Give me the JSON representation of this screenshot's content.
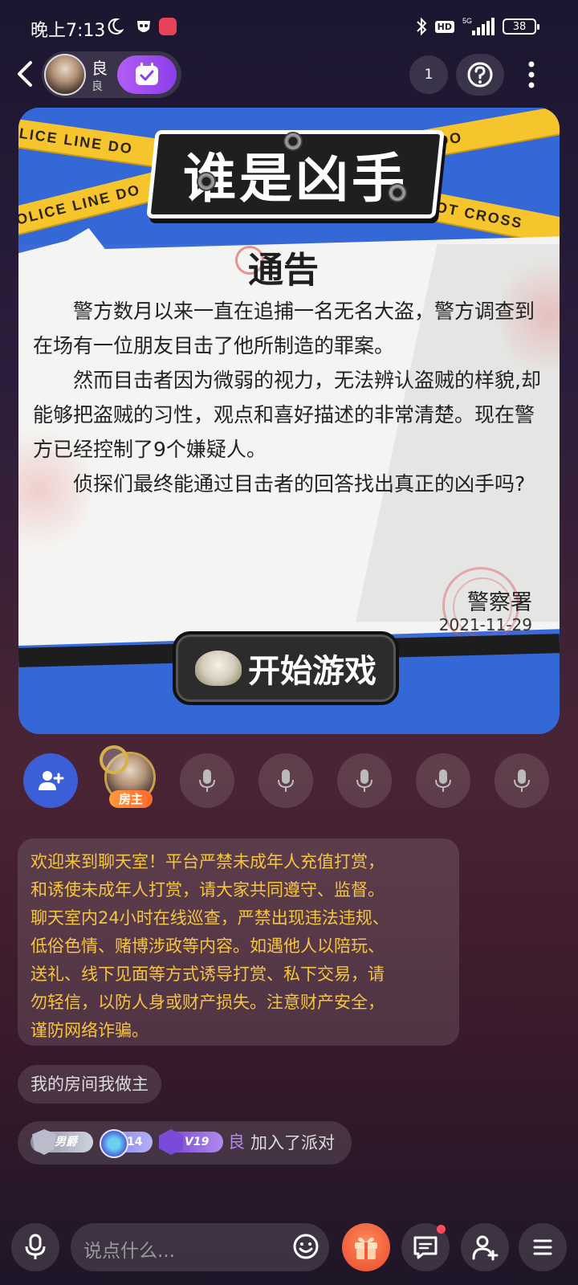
{
  "status_bar": {
    "time": "晚上7:13",
    "network": "5G",
    "hd": "HD",
    "battery": "38",
    "icons": [
      "moon-icon",
      "mask-app-icon",
      "app-icon",
      "bluetooth-icon",
      "signal-icon",
      "battery-icon"
    ]
  },
  "header": {
    "room_name": "良",
    "room_id": "良",
    "online_count": "1",
    "icons": [
      "back-icon",
      "checkin-icon",
      "help-icon",
      "more-icon"
    ]
  },
  "game_card": {
    "tape_text": "POLICE LINE DO",
    "tape_text_2": "POLICE LINE DO",
    "tape_text_3": "POLICE LINE DO",
    "tape_text_4": "NE DO NOT CROSS",
    "game_title": "谁是凶手",
    "notice_title": "通告",
    "notice_paragraphs": [
      "警方数月以来一直在追捕一名无名大盗，警方调查到在场有一位朋友目击了他所制造的罪案。",
      "然而目击者因为微弱的视力，无法辨认盗贼的样貌,却能够把盗贼的习性，观点和喜好描述的非常清楚。现在警方已经控制了9个嫌疑人。",
      "侦探们最终能通过目击者的回答找出真正的凶手吗?"
    ],
    "signer": "警察署",
    "date": "2021-11-29",
    "start_button": "开始游戏"
  },
  "seats": {
    "host_badge": "房主",
    "empty_seat_count": 5,
    "icons": [
      "add-user-icon",
      "mic-icon"
    ]
  },
  "chat": {
    "system_message_lines": [
      "欢迎来到聊天室！平台严禁未成年人充值打赏，",
      "和诱使未成年人打赏，请大家共同遵守、监督。",
      "聊天室内24小时在线巡查，严禁出现违法违规、",
      "低俗色情、赌博涉政等内容。如遇他人以陪玩、",
      "送礼、线下见面等方式诱导打赏、私下交易，请",
      "勿轻信，以防人身或财产损失。注意财产安全，",
      "谨防网络诈骗。"
    ],
    "room_rule": "我的房间我做主",
    "join_badges": {
      "knight": "男爵",
      "level": "14",
      "vip": "V19"
    },
    "join_user": "良",
    "join_text": "加入了派对"
  },
  "bottom_bar": {
    "input_placeholder": "说点什么...",
    "icons": [
      "mic-icon",
      "emoji-icon",
      "gift-icon",
      "message-icon",
      "add-friend-icon",
      "menu-icon"
    ]
  },
  "colors": {
    "accent_purple": "#8b3fe8",
    "system_text": "#f5c542",
    "invite_blue": "#3c5fd8",
    "card_blue": "#3468d6",
    "tape_yellow": "#f6c52d"
  }
}
